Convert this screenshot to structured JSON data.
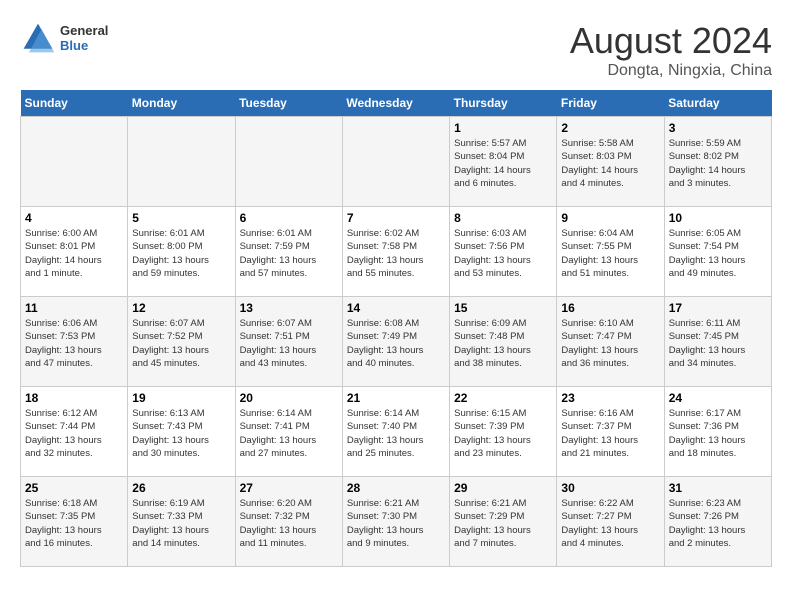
{
  "logo": {
    "general": "General",
    "blue": "Blue"
  },
  "title": "August 2024",
  "subtitle": "Dongta, Ningxia, China",
  "headers": [
    "Sunday",
    "Monday",
    "Tuesday",
    "Wednesday",
    "Thursday",
    "Friday",
    "Saturday"
  ],
  "weeks": [
    [
      {
        "day": "",
        "info": ""
      },
      {
        "day": "",
        "info": ""
      },
      {
        "day": "",
        "info": ""
      },
      {
        "day": "",
        "info": ""
      },
      {
        "day": "1",
        "info": "Sunrise: 5:57 AM\nSunset: 8:04 PM\nDaylight: 14 hours\nand 6 minutes."
      },
      {
        "day": "2",
        "info": "Sunrise: 5:58 AM\nSunset: 8:03 PM\nDaylight: 14 hours\nand 4 minutes."
      },
      {
        "day": "3",
        "info": "Sunrise: 5:59 AM\nSunset: 8:02 PM\nDaylight: 14 hours\nand 3 minutes."
      }
    ],
    [
      {
        "day": "4",
        "info": "Sunrise: 6:00 AM\nSunset: 8:01 PM\nDaylight: 14 hours\nand 1 minute."
      },
      {
        "day": "5",
        "info": "Sunrise: 6:01 AM\nSunset: 8:00 PM\nDaylight: 13 hours\nand 59 minutes."
      },
      {
        "day": "6",
        "info": "Sunrise: 6:01 AM\nSunset: 7:59 PM\nDaylight: 13 hours\nand 57 minutes."
      },
      {
        "day": "7",
        "info": "Sunrise: 6:02 AM\nSunset: 7:58 PM\nDaylight: 13 hours\nand 55 minutes."
      },
      {
        "day": "8",
        "info": "Sunrise: 6:03 AM\nSunset: 7:56 PM\nDaylight: 13 hours\nand 53 minutes."
      },
      {
        "day": "9",
        "info": "Sunrise: 6:04 AM\nSunset: 7:55 PM\nDaylight: 13 hours\nand 51 minutes."
      },
      {
        "day": "10",
        "info": "Sunrise: 6:05 AM\nSunset: 7:54 PM\nDaylight: 13 hours\nand 49 minutes."
      }
    ],
    [
      {
        "day": "11",
        "info": "Sunrise: 6:06 AM\nSunset: 7:53 PM\nDaylight: 13 hours\nand 47 minutes."
      },
      {
        "day": "12",
        "info": "Sunrise: 6:07 AM\nSunset: 7:52 PM\nDaylight: 13 hours\nand 45 minutes."
      },
      {
        "day": "13",
        "info": "Sunrise: 6:07 AM\nSunset: 7:51 PM\nDaylight: 13 hours\nand 43 minutes."
      },
      {
        "day": "14",
        "info": "Sunrise: 6:08 AM\nSunset: 7:49 PM\nDaylight: 13 hours\nand 40 minutes."
      },
      {
        "day": "15",
        "info": "Sunrise: 6:09 AM\nSunset: 7:48 PM\nDaylight: 13 hours\nand 38 minutes."
      },
      {
        "day": "16",
        "info": "Sunrise: 6:10 AM\nSunset: 7:47 PM\nDaylight: 13 hours\nand 36 minutes."
      },
      {
        "day": "17",
        "info": "Sunrise: 6:11 AM\nSunset: 7:45 PM\nDaylight: 13 hours\nand 34 minutes."
      }
    ],
    [
      {
        "day": "18",
        "info": "Sunrise: 6:12 AM\nSunset: 7:44 PM\nDaylight: 13 hours\nand 32 minutes."
      },
      {
        "day": "19",
        "info": "Sunrise: 6:13 AM\nSunset: 7:43 PM\nDaylight: 13 hours\nand 30 minutes."
      },
      {
        "day": "20",
        "info": "Sunrise: 6:14 AM\nSunset: 7:41 PM\nDaylight: 13 hours\nand 27 minutes."
      },
      {
        "day": "21",
        "info": "Sunrise: 6:14 AM\nSunset: 7:40 PM\nDaylight: 13 hours\nand 25 minutes."
      },
      {
        "day": "22",
        "info": "Sunrise: 6:15 AM\nSunset: 7:39 PM\nDaylight: 13 hours\nand 23 minutes."
      },
      {
        "day": "23",
        "info": "Sunrise: 6:16 AM\nSunset: 7:37 PM\nDaylight: 13 hours\nand 21 minutes."
      },
      {
        "day": "24",
        "info": "Sunrise: 6:17 AM\nSunset: 7:36 PM\nDaylight: 13 hours\nand 18 minutes."
      }
    ],
    [
      {
        "day": "25",
        "info": "Sunrise: 6:18 AM\nSunset: 7:35 PM\nDaylight: 13 hours\nand 16 minutes."
      },
      {
        "day": "26",
        "info": "Sunrise: 6:19 AM\nSunset: 7:33 PM\nDaylight: 13 hours\nand 14 minutes."
      },
      {
        "day": "27",
        "info": "Sunrise: 6:20 AM\nSunset: 7:32 PM\nDaylight: 13 hours\nand 11 minutes."
      },
      {
        "day": "28",
        "info": "Sunrise: 6:21 AM\nSunset: 7:30 PM\nDaylight: 13 hours\nand 9 minutes."
      },
      {
        "day": "29",
        "info": "Sunrise: 6:21 AM\nSunset: 7:29 PM\nDaylight: 13 hours\nand 7 minutes."
      },
      {
        "day": "30",
        "info": "Sunrise: 6:22 AM\nSunset: 7:27 PM\nDaylight: 13 hours\nand 4 minutes."
      },
      {
        "day": "31",
        "info": "Sunrise: 6:23 AM\nSunset: 7:26 PM\nDaylight: 13 hours\nand 2 minutes."
      }
    ]
  ]
}
